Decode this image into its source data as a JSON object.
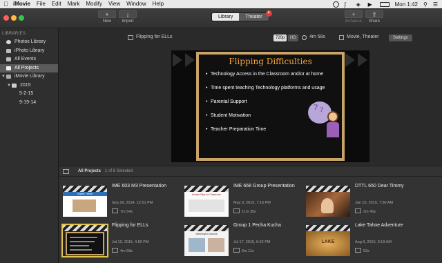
{
  "menubar": {
    "app": "iMovie",
    "items": [
      "File",
      "Edit",
      "Mark",
      "Modify",
      "View",
      "Window",
      "Help"
    ],
    "clock": "Mon 1:42"
  },
  "toolbar": {
    "new_label": "New",
    "import_label": "Import",
    "tab_library": "Library",
    "tab_theater": "Theater",
    "theater_badge": "4",
    "enhance_label": "Enhance",
    "share_label": "Share"
  },
  "sidebar": {
    "heading": "LIBRARIES",
    "items": [
      {
        "label": "Photos Library",
        "icon": "photos-icon",
        "depth": 0
      },
      {
        "label": "iPhoto Library",
        "icon": "iphoto-icon",
        "depth": 0
      },
      {
        "label": "All Events",
        "icon": "events-icon",
        "depth": 0
      },
      {
        "label": "All Projects",
        "icon": "projects-icon",
        "depth": 0,
        "selected": true
      },
      {
        "label": "iMovie Library",
        "icon": "film-icon",
        "depth": 0,
        "disclosure": "▼"
      },
      {
        "label": "2015",
        "icon": "folder-icon",
        "depth": 1,
        "disclosure": "▼"
      },
      {
        "label": "5-2-15",
        "depth": 2
      },
      {
        "label": "9-19-14",
        "depth": 2
      }
    ]
  },
  "viewer": {
    "project_name": "Flipping for ELLs",
    "quality_720": "720p",
    "quality_hd": "HD",
    "duration": "4m 58s",
    "destinations": "Movie, Theater",
    "settings_label": "Settings",
    "slide": {
      "title": "Flipping Difficulties",
      "bullets": [
        "Technology Access in the Classroom and/or at home",
        "Time spent teaching Technology platforms and usage",
        "Parental Support",
        "Student Motivation",
        "Teacher Preparation Time"
      ]
    }
  },
  "browser": {
    "heading": "All Projects",
    "selection": "1 of 6 Selected",
    "projects": [
      {
        "title": "IME 603 M3 Presentation",
        "date": "Sep 29, 2014, 12:51 PM",
        "length": "7m 54s",
        "thumb_caption": "Week Three"
      },
      {
        "title": "IME 668 Group Presentation",
        "date": "May 3, 2015, 7:16 PM",
        "length": "11m 35s",
        "thumb_caption": "Answer Ripe for Classroom"
      },
      {
        "title": "DTTL 650 Dear Timmy",
        "date": "Jun 15, 2015, 7:30 AM",
        "length": "3m 45s"
      },
      {
        "title": "Flipping for ELLs",
        "date": "Jul 10, 2015, 4:50 PM",
        "length": "4m 58s",
        "selected": true
      },
      {
        "title": "Group 1 Pecha Kucha",
        "date": "Jul 17, 2015, 6:52 PM",
        "length": "6m 11s",
        "thumb_caption": "Meaningful Lessons"
      },
      {
        "title": "Lake Tahoe Adventure",
        "date": "Aug 9, 2015, 9:19 AM",
        "length": "53s",
        "thumb_caption": "LAKE"
      }
    ]
  }
}
